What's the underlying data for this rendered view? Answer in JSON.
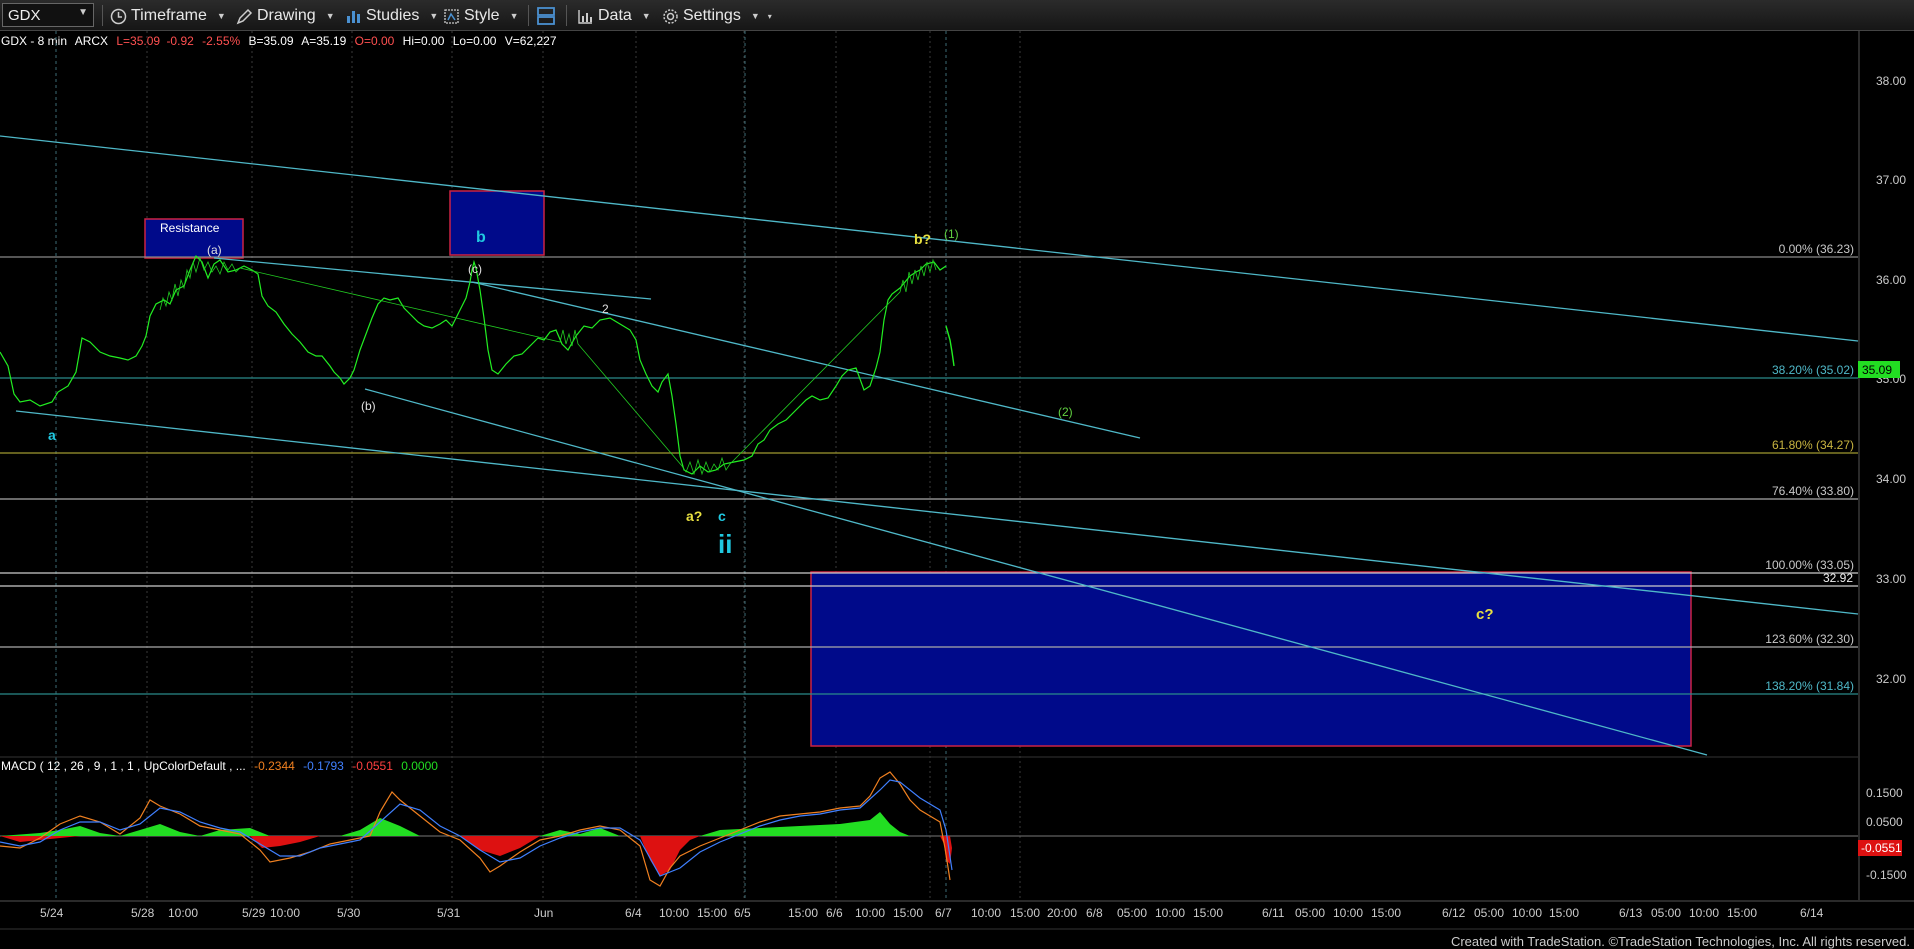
{
  "toolbar": {
    "symbol": "GDX",
    "timeframe_label": "Timeframe",
    "drawing_label": "Drawing",
    "studies_label": "Studies",
    "style_label": "Style",
    "data_label": "Data",
    "settings_label": "Settings"
  },
  "info": {
    "symbol": "GDX - 8 min",
    "exchange": "ARCX",
    "last": "L=35.09",
    "change": "-0.92",
    "change_pct": "-2.55%",
    "bid": "B=35.09",
    "ask": "A=35.19",
    "open": "O=0.00",
    "high": "Hi=0.00",
    "low": "Lo=0.00",
    "volume": "V=62,227"
  },
  "macd": {
    "title": "MACD ( 12 , 26 , 9 , 1 , 1 , UpColorDefault , ...",
    "macd_value": "-0.2344",
    "signal_value": "-0.1793",
    "diff_value": "-0.0551",
    "zero_value": "0.0000",
    "axis_labels": [
      "0.1500",
      "0.0500",
      "-0.1500"
    ],
    "current_label": "-0.0551"
  },
  "price_axis": {
    "labels": [
      "38.00",
      "37.00",
      "36.00",
      "35.00",
      "34.00",
      "33.00",
      "32.00"
    ],
    "current_price": "35.09",
    "line_3292": "32.92"
  },
  "fib_levels": [
    {
      "label": "0.00% (36.23)",
      "price": 36.23
    },
    {
      "label": "38.20% (35.02)",
      "price": 35.02
    },
    {
      "label": "61.80% (34.27)",
      "price": 34.27
    },
    {
      "label": "76.40% (33.80)",
      "price": 33.8
    },
    {
      "label": "100.00% (33.05)",
      "price": 33.05
    },
    {
      "label": "123.60% (32.30)",
      "price": 32.3
    },
    {
      "label": "138.20% (31.84)",
      "price": 31.84
    }
  ],
  "annotations": {
    "resistance": "Resistance",
    "b_box": "b",
    "wave_a": "a",
    "wave_a_paren": "(a)",
    "wave_b_paren": "(b)",
    "wave_c_paren": "(c)",
    "wave_2": "2",
    "wave_a_q": "a?",
    "wave_c": "c",
    "wave_ii": "ii",
    "wave_b_q": "b?",
    "wave_1_paren": "(1)",
    "wave_2_paren": "(2)",
    "wave_c_q": "c?"
  },
  "time_axis": {
    "labels": [
      "5/24",
      "5/28",
      "10:00",
      "5/29",
      "10:00",
      "5/30",
      "5/31",
      "Jun",
      "6/4",
      "10:00",
      "15:00",
      "6/5",
      "15:00",
      "6/6",
      "10:00",
      "15:00",
      "6/7",
      "10:00",
      "15:00",
      "20:00",
      "6/8",
      "05:00",
      "10:00",
      "15:00",
      "6/11",
      "05:00",
      "10:00",
      "15:00",
      "6/12",
      "05:00",
      "10:00",
      "15:00",
      "6/13",
      "05:00",
      "10:00",
      "15:00",
      "6/14"
    ]
  },
  "footer": "Created with TradeStation. ©TradeStation Technologies, Inc. All rights reserved.",
  "colors": {
    "price": "#22ee22",
    "trendline": "#4fb8c8",
    "box_fill": "#000a8a",
    "box_border": "#cc2244",
    "wave_yellow": "#e8e040",
    "wave_cyan": "#20c8e0",
    "wave_white": "#e0e0e0",
    "wave_green": "#60d040",
    "macd_orange": "#f08020",
    "macd_blue": "#4080ff",
    "hist_green": "#22dd22",
    "hist_red": "#dd1111"
  }
}
